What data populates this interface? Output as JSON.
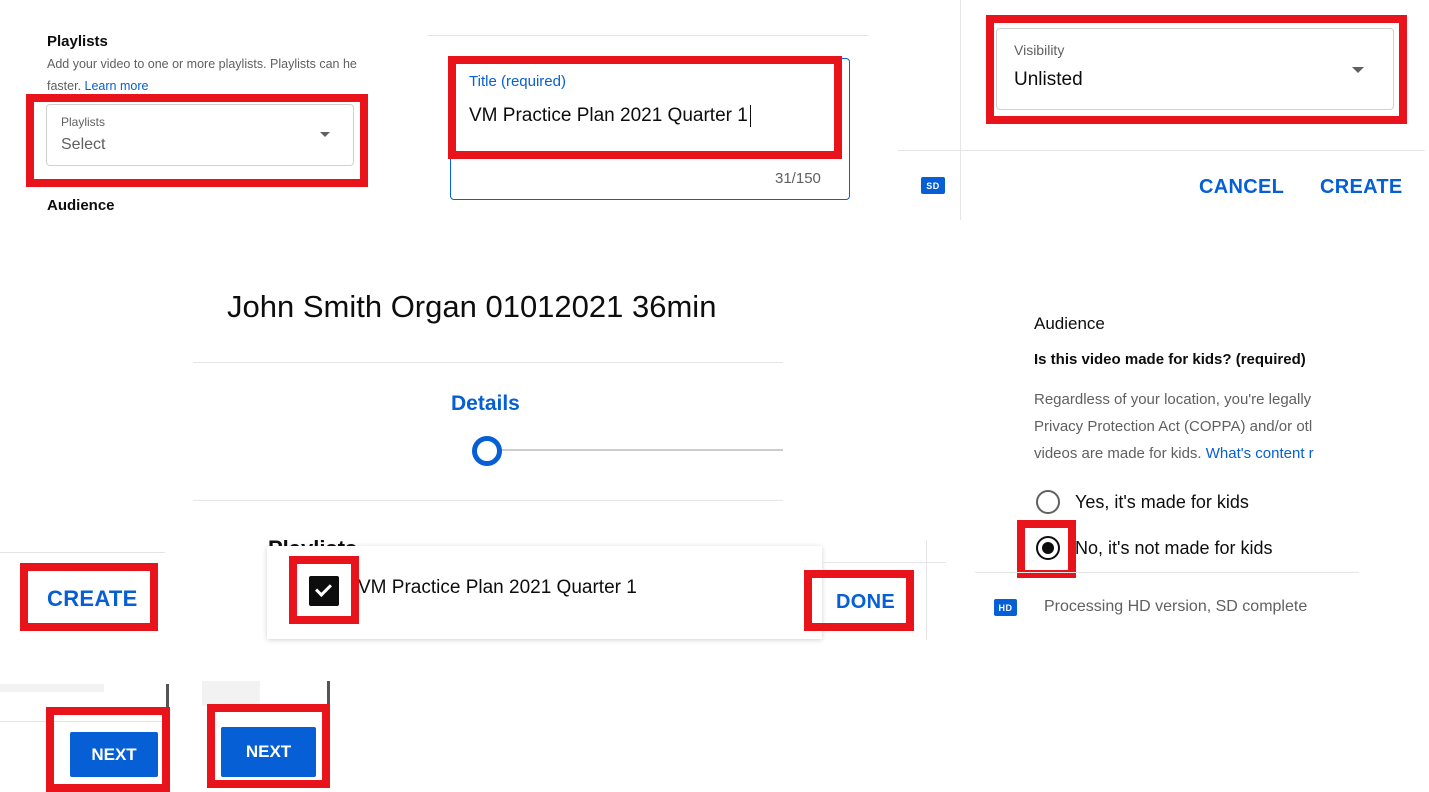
{
  "playlists_panel": {
    "heading": "Playlists",
    "description_line1": "Add your video to one or more playlists. Playlists can he",
    "description_line2": "faster.",
    "learn_more": "Learn more",
    "dropdown_label": "Playlists",
    "dropdown_value": "Select",
    "audience_heading": "Audience"
  },
  "title_panel": {
    "field_label": "Title (required)",
    "field_value": "VM Practice Plan 2021 Quarter 1",
    "char_count": "31/150"
  },
  "visibility_panel": {
    "field_label": "Visibility",
    "field_value": "Unlisted",
    "badge": "SD",
    "cancel_label": "CANCEL",
    "create_label": "CREATE"
  },
  "upload_dialog": {
    "video_title": "John Smith Organ 01012021 36min",
    "step_label": "Details",
    "section_partial": "Playlists"
  },
  "audience_panel": {
    "heading": "Audience",
    "question": "Is this video made for kids? (required)",
    "desc_line1": "Regardless of your location, you're legally",
    "desc_line2": "Privacy Protection Act (COPPA) and/or otl",
    "desc_line3": "videos are made for kids.",
    "desc_link": "What's content r",
    "option_yes": "Yes, it's made for kids",
    "option_no": "No, it's not made for kids",
    "badge": "HD",
    "processing_status": "Processing HD version, SD complete"
  },
  "create_snippet": {
    "create_label": "CREATE"
  },
  "playlist_item": {
    "label": "VM Practice Plan 2021 Quarter 1"
  },
  "done_snippet": {
    "done_label": "DONE"
  },
  "next_snippets": {
    "next_label_1": "NEXT",
    "next_label_2": "NEXT"
  }
}
